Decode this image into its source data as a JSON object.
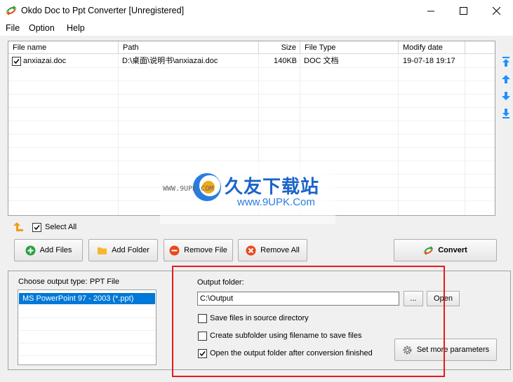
{
  "window": {
    "title": "Okdo Doc to Ppt Converter [Unregistered]",
    "minimize_icon": "minimize-icon",
    "maximize_icon": "maximize-icon",
    "close_icon": "close-icon"
  },
  "menu": {
    "items": [
      "File",
      "Option",
      "Help"
    ]
  },
  "file_list": {
    "columns": [
      "File name",
      "Path",
      "Size",
      "File Type",
      "Modify date"
    ],
    "rows": [
      {
        "checked": true,
        "name": "anxiazai.doc",
        "path": "D:\\桌面\\说明书\\anxiazai.doc",
        "size": "140KB",
        "type": "DOC 文档",
        "date": "19-07-18 19:17"
      }
    ]
  },
  "side_buttons": [
    "move-top-icon",
    "move-up-icon",
    "move-down-icon",
    "move-bottom-icon"
  ],
  "watermark": {
    "cn": "久友下载站",
    "url": "www.9UPK.Com",
    "small": "WWW.9UPK.COM"
  },
  "select_all": {
    "label": "Select All",
    "checked": true
  },
  "toolbar": {
    "add_files": "Add Files",
    "add_folder": "Add Folder",
    "remove_file": "Remove File",
    "remove_all": "Remove All",
    "convert": "Convert"
  },
  "output_type": {
    "label": "Choose output type:",
    "value": "PPT File",
    "options": [
      "MS PowerPoint 97 - 2003 (*.ppt)"
    ]
  },
  "output": {
    "folder_label": "Output folder:",
    "folder_value": "C:\\Output",
    "browse_label": "...",
    "open_label": "Open",
    "opt_save_source": "Save files in source directory",
    "opt_subfolder": "Create subfolder using filename to save files",
    "opt_open_after": "Open the output folder after conversion finished",
    "more_params": "Set more parameters",
    "checks": {
      "save_source": false,
      "subfolder": false,
      "open_after": true
    }
  },
  "colors": {
    "selection": "#0078d7",
    "highlight_frame": "#e8191c",
    "side_arrow": "#1e90ff"
  }
}
